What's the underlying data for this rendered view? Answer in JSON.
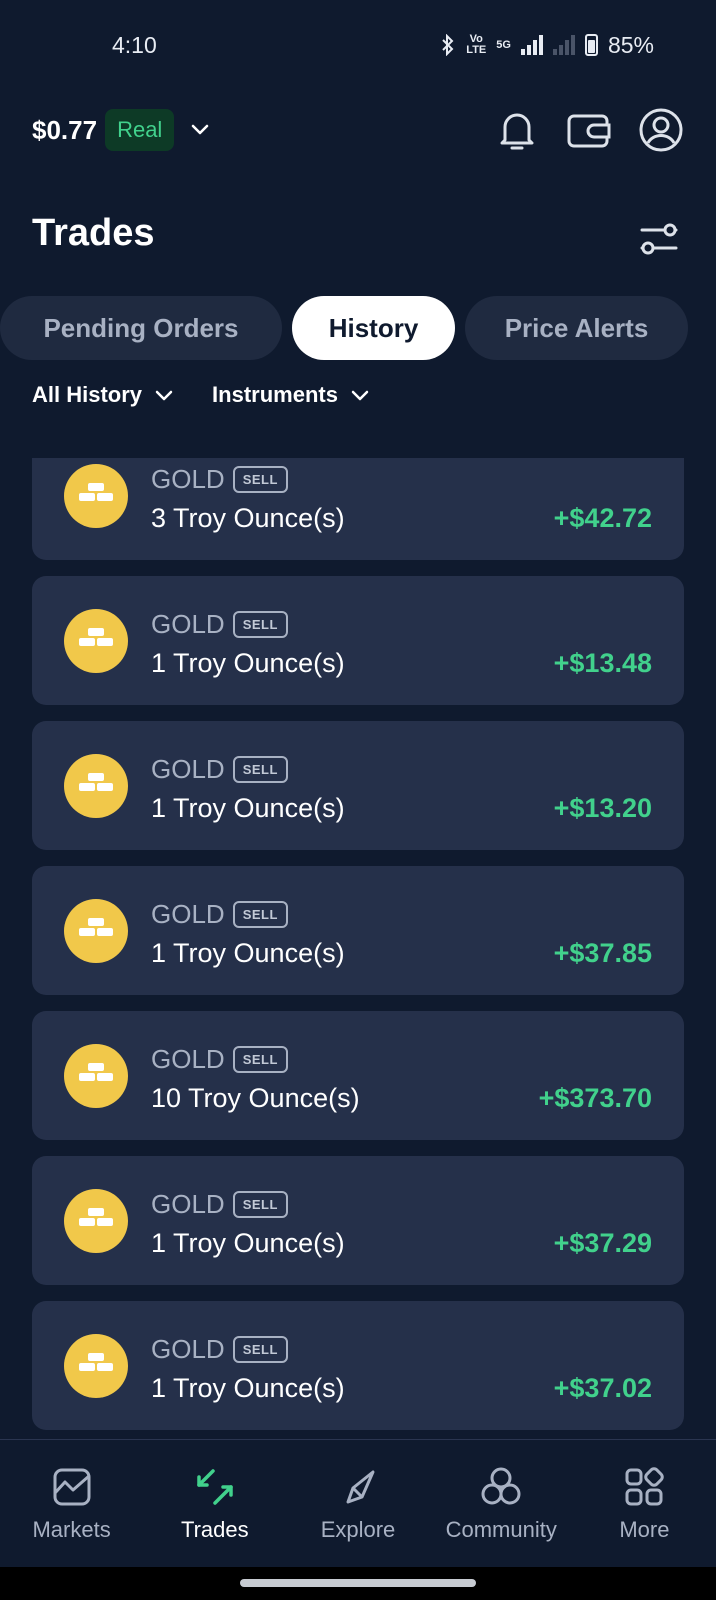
{
  "status_bar": {
    "time": "4:10",
    "volte_top": "Vo",
    "volte_bottom": "LTE",
    "network": "5G",
    "battery": "85%"
  },
  "header": {
    "balance": "$0.77",
    "account_type": "Real"
  },
  "page": {
    "title": "Trades"
  },
  "tabs": [
    {
      "label": "Pending Orders",
      "active": false
    },
    {
      "label": "History",
      "active": true
    },
    {
      "label": "Price Alerts",
      "active": false
    }
  ],
  "filters": {
    "history": "All History",
    "instruments": "Instruments"
  },
  "trades": [
    {
      "symbol": "GOLD",
      "side": "SELL",
      "quantity": "3 Troy Ounce(s)",
      "pnl": "+$42.72"
    },
    {
      "symbol": "GOLD",
      "side": "SELL",
      "quantity": "1 Troy Ounce(s)",
      "pnl": "+$13.48"
    },
    {
      "symbol": "GOLD",
      "side": "SELL",
      "quantity": "1 Troy Ounce(s)",
      "pnl": "+$13.20"
    },
    {
      "symbol": "GOLD",
      "side": "SELL",
      "quantity": "1 Troy Ounce(s)",
      "pnl": "+$37.85"
    },
    {
      "symbol": "GOLD",
      "side": "SELL",
      "quantity": "10 Troy Ounce(s)",
      "pnl": "+$373.70"
    },
    {
      "symbol": "GOLD",
      "side": "SELL",
      "quantity": "1 Troy Ounce(s)",
      "pnl": "+$37.29"
    },
    {
      "symbol": "GOLD",
      "side": "SELL",
      "quantity": "1 Troy Ounce(s)",
      "pnl": "+$37.02"
    }
  ],
  "bottom_nav": [
    {
      "label": "Markets",
      "icon": "chart-icon",
      "active": false
    },
    {
      "label": "Trades",
      "icon": "arrows-icon",
      "active": true
    },
    {
      "label": "Explore",
      "icon": "compass-icon",
      "active": false
    },
    {
      "label": "Community",
      "icon": "community-icon",
      "active": false
    },
    {
      "label": "More",
      "icon": "grid-icon",
      "active": false
    }
  ],
  "colors": {
    "background": "#0f1a2e",
    "card": "#25304a",
    "profit": "#41d18c",
    "gold": "#f1c84a",
    "accent_green": "#41d18c"
  }
}
